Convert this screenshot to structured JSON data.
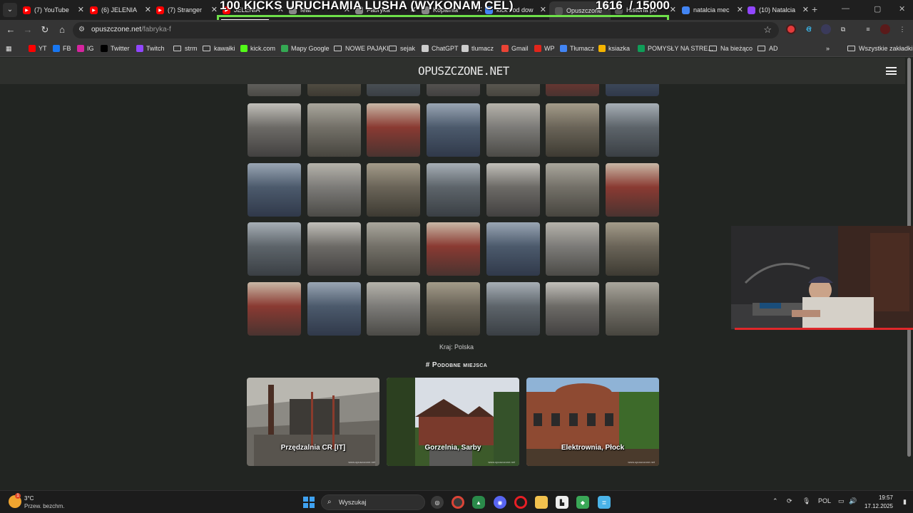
{
  "stream": {
    "title": "100 KICKS URUCHAMIA LUSHA (WYKONAM CEL)",
    "goal_current": "1616",
    "goal_target": "/ 15000",
    "goal_progress": 0.108
  },
  "tabs": [
    {
      "label": "(7) YouTube",
      "icon": "youtube-icon",
      "color": "#ff0000"
    },
    {
      "label": "(6) JELENIA",
      "icon": "youtube-icon",
      "color": "#ff0000"
    },
    {
      "label": "(7) Stranger",
      "icon": "youtube-icon",
      "color": "#ff0000"
    },
    {
      "label": "JELENIA",
      "icon": "youtube-icon",
      "color": "#ff0000"
    },
    {
      "label": "feat",
      "icon": "page-icon",
      "color": "#888888"
    },
    {
      "label": "Fabryka",
      "icon": "page-icon",
      "color": "#888888"
    },
    {
      "label": "Kopalnia",
      "icon": "page-icon",
      "color": "#888888"
    },
    {
      "label": "kick vod dow",
      "icon": "google-icon",
      "color": "#4285f4"
    },
    {
      "label": "Opuszczone",
      "icon": "page-icon",
      "color": "#555555"
    },
    {
      "label": "Historia po",
      "icon": "page-icon",
      "color": "#555555"
    },
    {
      "label": "natalcia mec",
      "icon": "google-icon",
      "color": "#4285f4"
    },
    {
      "label": "(10) Natalcia",
      "icon": "twitch-icon",
      "color": "#9146ff"
    }
  ],
  "omnibox": {
    "domain": "opuszczone.net",
    "path": "/fabryka-f"
  },
  "bookmarks": [
    {
      "label": "YT",
      "icon": "youtube-icon",
      "color": "#ff0000"
    },
    {
      "label": "FB",
      "icon": "facebook-icon",
      "color": "#1877f2"
    },
    {
      "label": "IG",
      "icon": "instagram-icon",
      "color": "#d6249f"
    },
    {
      "label": "Twitter",
      "icon": "x-icon",
      "color": "#000000"
    },
    {
      "label": "Twitch",
      "icon": "twitch-icon",
      "color": "#9146ff"
    },
    {
      "label": "strm",
      "icon": "folder-icon",
      "color": ""
    },
    {
      "label": "kawałki",
      "icon": "folder-icon",
      "color": ""
    },
    {
      "label": "kick.com",
      "icon": "kick-icon",
      "color": "#53fc18"
    },
    {
      "label": "Mapy Google",
      "icon": "maps-icon",
      "color": "#34a853"
    },
    {
      "label": "NOWE PAJĄKI",
      "icon": "folder-icon",
      "color": ""
    },
    {
      "label": "sejak",
      "icon": "folder-icon",
      "color": ""
    },
    {
      "label": "ChatGPT",
      "icon": "chatgpt-icon",
      "color": "#cccccc"
    },
    {
      "label": "tlumacz",
      "icon": "chatgpt-icon",
      "color": "#cccccc"
    },
    {
      "label": "Gmail",
      "icon": "gmail-icon",
      "color": "#ea4335"
    },
    {
      "label": "WP",
      "icon": "wp-icon",
      "color": "#e1251b"
    },
    {
      "label": "Tłumacz",
      "icon": "translate-icon",
      "color": "#4285f4"
    },
    {
      "label": "ksiazka",
      "icon": "grid-icon",
      "color": "#f4b400"
    },
    {
      "label": "POMYSŁY NA STRE...",
      "icon": "grid-icon",
      "color": "#0f9d58"
    },
    {
      "label": "Na bieżąco",
      "icon": "folder-icon",
      "color": ""
    },
    {
      "label": "AD",
      "icon": "folder-icon",
      "color": ""
    }
  ],
  "all_bookmarks": "Wszystkie zakładki",
  "site": {
    "logo": "OPUSZCZONE.NET"
  },
  "country": "Kraj: Polska",
  "similar_title": "# Podobne miejsca",
  "similar": [
    {
      "title": "Przędzalnia CR [IT]",
      "wm": "www.opuszczone.net"
    },
    {
      "title": "Gorzelnia, Sarby",
      "wm": "www.opuszczone.net"
    },
    {
      "title": "Elektrownia, Płock",
      "wm": "www.opuszczone.net"
    }
  ],
  "taskbar": {
    "temp": "3°C",
    "weather": "Przew. bezchm.",
    "search_placeholder": "Wyszukaj",
    "lang": "POL",
    "time": "19:57",
    "date": "17.12.2025"
  }
}
